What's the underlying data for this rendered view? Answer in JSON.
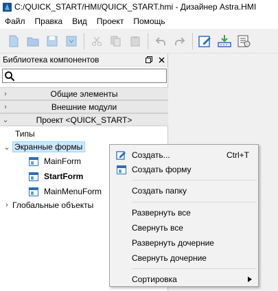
{
  "window": {
    "title": "C:/QUICK_START/HMI/QUICK_START.hmi - Дизайнер Astra.HMI"
  },
  "menubar": {
    "items": [
      "Файл",
      "Правка",
      "Вид",
      "Проект",
      "Помощь"
    ]
  },
  "toolbar": {
    "buttons": [
      "new-document-icon",
      "open-folder-icon",
      "save-icon",
      "save-all-icon",
      "cut-icon",
      "copy-icon",
      "paste-icon",
      "undo-icon",
      "redo-icon",
      "edit-icon",
      "download-icon",
      "build-icon"
    ]
  },
  "panel": {
    "title": "Библиотека компонентов",
    "search": {
      "value": "",
      "placeholder": ""
    },
    "sections": [
      "Общие элементы",
      "Внешние модули",
      "Проект <QUICK_START>"
    ],
    "tree": {
      "types": "Типы",
      "screen_forms": "Экранные формы",
      "forms": [
        "MainForm",
        "StartForm",
        "MainMenuForm"
      ],
      "global_objects": "Глобальные объекты"
    }
  },
  "context_menu": {
    "create": "Создать...",
    "create_shortcut": "Ctrl+T",
    "create_form": "Создать форму",
    "create_folder": "Создать папку",
    "expand_all": "Развернуть все",
    "collapse_all": "Свернуть все",
    "expand_children": "Развернуть дочерние",
    "collapse_children": "Свернуть дочерние",
    "sort": "Сортировка"
  },
  "colors": {
    "accent": "#2a6fb8",
    "selection": "#cde8ff",
    "menu_bg": "#f2f2f2"
  }
}
